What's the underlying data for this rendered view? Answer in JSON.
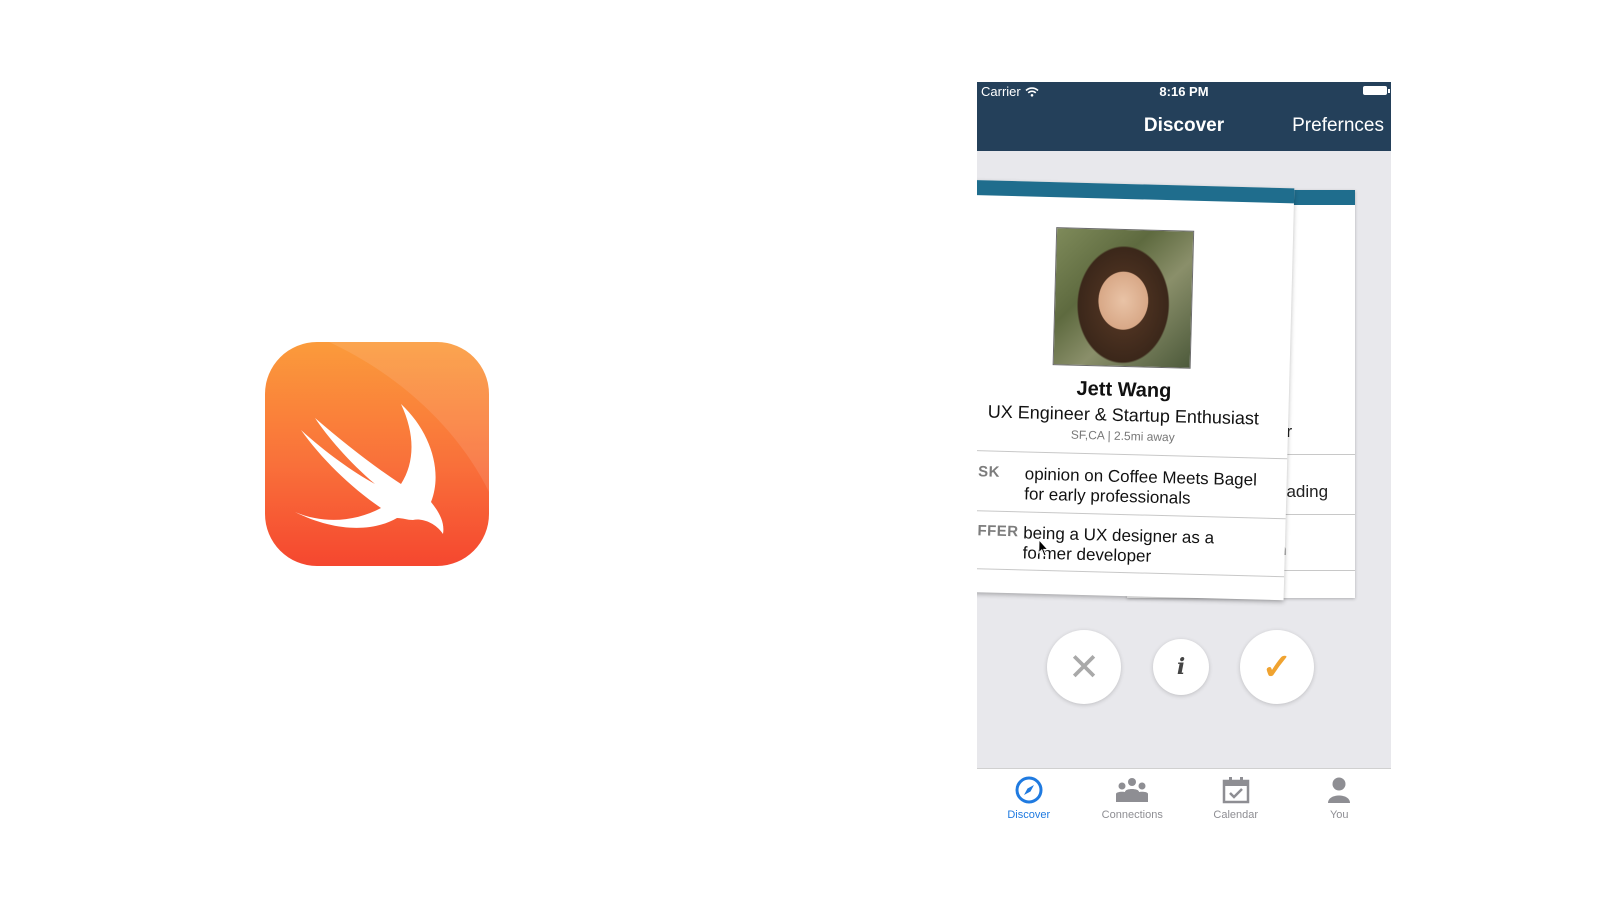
{
  "logo": {
    "icon": "swift-bird-icon",
    "colors": {
      "top": "#fb9b3b",
      "bottom": "#f5472f"
    }
  },
  "status_bar": {
    "carrier": "Carrier",
    "time": "8:16 PM"
  },
  "nav": {
    "title": "Discover",
    "right_button": "Prefernces",
    "background": "#24405a"
  },
  "front_card": {
    "name": "Jett Wang",
    "role": "UX Engineer & Startup Enthusiast",
    "location": "SF,CA | 2.5mi away",
    "rows": [
      {
        "tag": "ASK",
        "text": "opinion on Coffee Meets Bagel for early professionals"
      },
      {
        "tag": "OFFER",
        "text": "being a UX designer as a former developer"
      }
    ]
  },
  "back_card": {
    "role_fragment": "er",
    "rows": [
      {
        "text": "eading"
      },
      {
        "text": "n"
      }
    ]
  },
  "actions": {
    "reject": {
      "glyph": "✕",
      "icon": "close-icon"
    },
    "info": {
      "glyph": "i",
      "icon": "info-icon"
    },
    "accept": {
      "glyph": "✓",
      "icon": "checkmark-icon",
      "color": "#f0a330"
    }
  },
  "tabs": [
    {
      "label": "Discover",
      "icon": "compass-icon",
      "active": true
    },
    {
      "label": "Connections",
      "icon": "people-icon",
      "active": false
    },
    {
      "label": "Calendar",
      "icon": "calendar-icon",
      "active": false
    },
    {
      "label": "You",
      "icon": "person-icon",
      "active": false
    }
  ],
  "accent_color": "#1f7ae0"
}
